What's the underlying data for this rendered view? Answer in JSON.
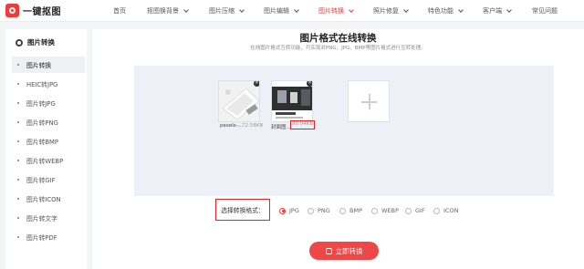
{
  "header": {
    "logo_text": "一键抠图",
    "nav": [
      {
        "label": "首页"
      },
      {
        "label": "抠图换背景"
      },
      {
        "label": "图片压缩"
      },
      {
        "label": "图片编辑"
      },
      {
        "label": "图片转换"
      },
      {
        "label": "照片修复"
      },
      {
        "label": "特色功能"
      },
      {
        "label": "客户端"
      },
      {
        "label": "常见问题"
      }
    ]
  },
  "sidebar": {
    "title": "图片转换",
    "items": [
      {
        "label": "图片转换"
      },
      {
        "label": "HEIC转JPG"
      },
      {
        "label": "图片转JPG"
      },
      {
        "label": "图片转PNG"
      },
      {
        "label": "图片转BMP"
      },
      {
        "label": "图片转WEBP"
      },
      {
        "label": "图片转GIF"
      },
      {
        "label": "图片转ICON"
      },
      {
        "label": "图片转文字"
      },
      {
        "label": "图片转PDF"
      }
    ]
  },
  "main": {
    "title": "图片格式在线转换",
    "subtitle": "在线图片格式互转功能，可实现对PNG、JPG、BMP等图片格式进行互转处理。",
    "files": [
      {
        "name": "pexels-...",
        "size": "72.58KB"
      },
      {
        "name": "封面图...",
        "size": "90.04KB"
      }
    ],
    "format_label": "选择转换格式：",
    "formats": [
      "JPG",
      "PNG",
      "BMP",
      "WEBP",
      "GIF",
      "ICON"
    ],
    "selected_format": "JPG",
    "convert_button": "立即转换"
  },
  "colors": {
    "accent": "#ef3b3b",
    "highlight_box": "#e02525"
  }
}
